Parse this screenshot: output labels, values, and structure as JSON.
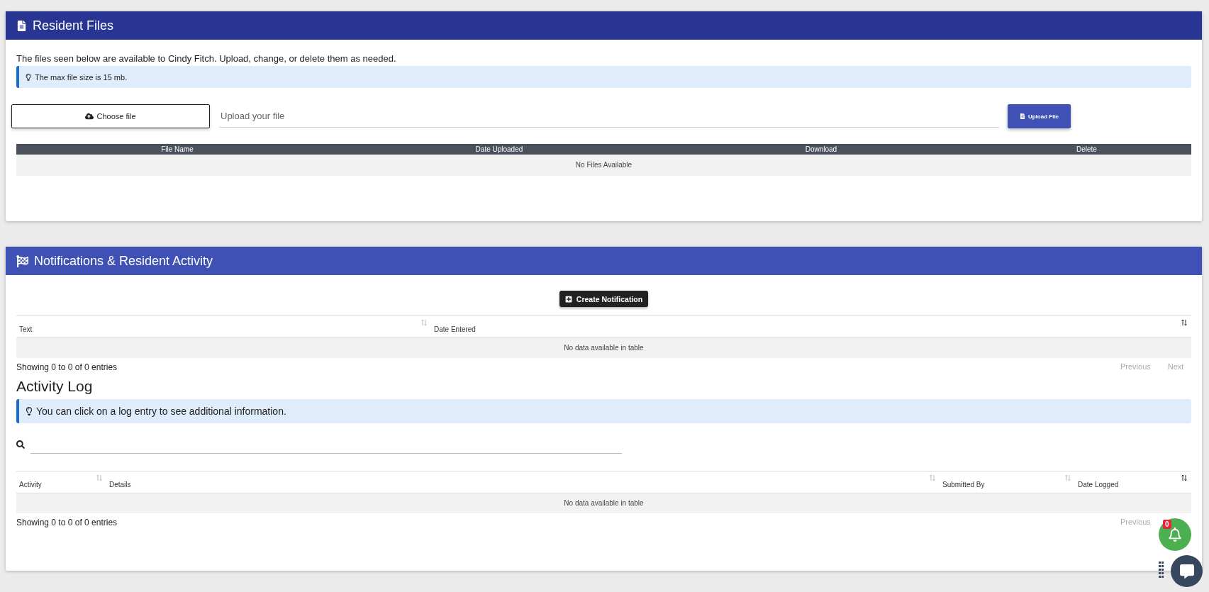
{
  "files_panel": {
    "title": "Resident Files",
    "description": "The files seen below are available to Cindy Fitch. Upload, change, or delete them as needed.",
    "tip": "The max file size is 15 mb.",
    "choose_button": "Choose file",
    "upload_field": {
      "placeholder": "Upload your file"
    },
    "upload_button": "Upload File",
    "table": {
      "columns": [
        "File Name",
        "Date Uploaded",
        "Download",
        "Delete"
      ],
      "empty_text": "No Files Available"
    }
  },
  "activity_panel": {
    "title": "Notifications & Resident Activity",
    "create_button": "Create Notification",
    "notifications_table": {
      "columns": [
        {
          "label": "Text",
          "sorted": false
        },
        {
          "label": "Date Entered",
          "sorted": true
        }
      ],
      "empty_text": "No data available in table",
      "info": "Showing 0 to 0 of 0 entries",
      "pager": [
        {
          "label": "Previous",
          "disabled": true
        },
        {
          "label": "Next",
          "disabled": true
        }
      ]
    },
    "log_title": "Activity Log",
    "log_tip": "You can click on a log entry to see additional information.",
    "log_table": {
      "columns": [
        {
          "label": "Activity",
          "sorted": false
        },
        {
          "label": "Details",
          "sorted": false
        },
        {
          "label": "Submitted By",
          "sorted": false
        },
        {
          "label": "Date Logged",
          "sorted": true
        }
      ],
      "empty_text": "No data available in table",
      "info": "Showing 0 to 0 of 0 entries",
      "pager": [
        {
          "label": "Previous",
          "disabled": true
        }
      ]
    }
  },
  "notification_badge": "0"
}
